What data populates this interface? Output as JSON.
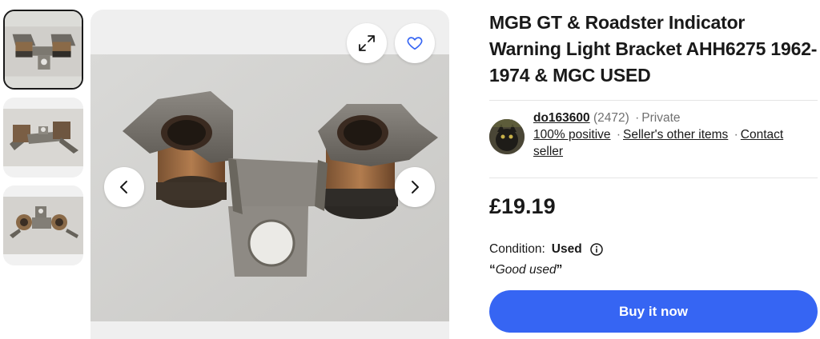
{
  "gallery": {
    "thumbnails": [
      {
        "alt": "thumb-1"
      },
      {
        "alt": "thumb-2"
      },
      {
        "alt": "thumb-3"
      }
    ],
    "buttons": {
      "expand": "expand-icon",
      "favorite": "heart-icon",
      "prev": "chevron-left-icon",
      "next": "chevron-right-icon"
    }
  },
  "listing": {
    "title": "MGB GT & Roadster Indicator Warning Light Bracket AHH6275 1962-1974 & MGC USED",
    "price": "£19.19",
    "condition_label": "Condition:",
    "condition_value": "Used",
    "condition_note_open": "“",
    "condition_note": "Good used",
    "condition_note_close": "”",
    "buy_label": "Buy it now"
  },
  "seller": {
    "name": "do163600",
    "feedback_count": "(2472)",
    "separator": "·",
    "type": "Private",
    "positive": "100% positive",
    "other_items": "Seller's other items",
    "contact": "Contact seller"
  },
  "colors": {
    "accent": "#3665f3",
    "text": "#191919",
    "muted": "#707070"
  }
}
